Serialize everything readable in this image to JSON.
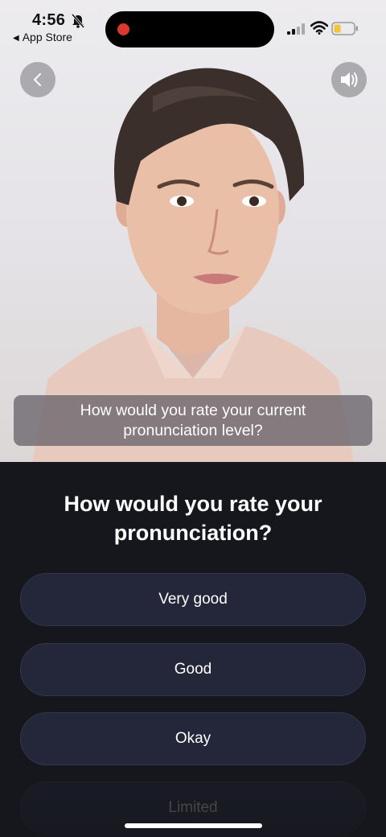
{
  "status_bar": {
    "time": "4:56",
    "back_app_label": "App Store",
    "icons": [
      "bell-slash-icon",
      "signal-icon",
      "wifi-icon",
      "battery-icon"
    ],
    "battery_level": 0.35,
    "battery_color": "#f5c23a",
    "recording_color": "#d93a2b"
  },
  "video": {
    "back_icon": "chevron-left-icon",
    "sound_icon": "speaker-icon",
    "subtitle": "How would you rate your current pronunciation level?"
  },
  "main": {
    "question": "How would you rate your pronunciation?",
    "options": [
      {
        "label": "Very good"
      },
      {
        "label": "Good"
      },
      {
        "label": "Okay"
      },
      {
        "label": "Limited"
      }
    ]
  },
  "colors": {
    "panel_background": "#16171d",
    "option_background": "#242739"
  }
}
